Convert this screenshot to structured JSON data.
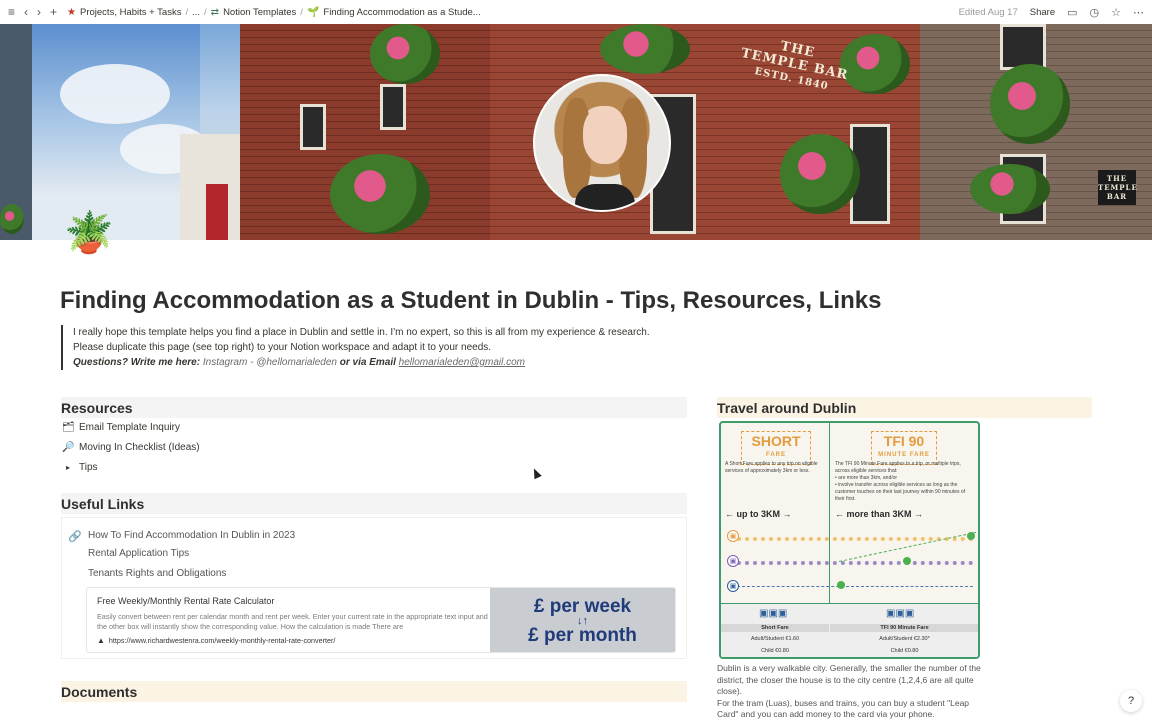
{
  "topbar": {
    "breadcrumbs": [
      {
        "icon": "★",
        "label": "Projects, Habits + Tasks"
      },
      {
        "icon": "",
        "label": "..."
      },
      {
        "icon": "⇄",
        "label": "Notion Templates"
      },
      {
        "icon": "🌱",
        "label": "Finding Accommodation as a Stude..."
      }
    ],
    "edited": "Edited Aug 17",
    "share": "Share"
  },
  "page": {
    "icon": "🪴",
    "title": "Finding Accommodation as a Student in Dublin - Tips, Resources, Links"
  },
  "callout": {
    "line1": "I really hope this template helps you find a place in Dublin and settle in. I'm no expert, so this is all from my experience & research.",
    "line2": "Please duplicate this page (see top right) to your Notion workspace and adapt it to your needs.",
    "q_label": "Questions? Write me here:",
    "instagram": "Instagram - @hellomarialeden",
    "or_email": "or via Email",
    "email": "hellomarialeden@gmail.com"
  },
  "cover": {
    "sign1": "THE",
    "sign2": "TEMPLE BAR",
    "sign3": "ESTD. 1840",
    "sign_right1": "THE",
    "sign_right2": "TEMPLE",
    "sign_right3": "BAR"
  },
  "resources": {
    "heading": "Resources",
    "items": [
      {
        "icon": "🗂",
        "label": "Email Template Inquiry"
      },
      {
        "icon": "🔎",
        "label": "Moving In Checklist (Ideas)"
      },
      {
        "icon": "▸",
        "label": "Tips"
      }
    ]
  },
  "useful_links": {
    "heading": "Useful Links",
    "items": [
      "How To Find Accommodation In Dublin in 2023",
      "Rental Application Tips",
      "Tenants Rights and Obligations"
    ],
    "bookmark": {
      "title": "Free Weekly/Monthly Rental Rate Calculator",
      "description": "Easily convert between rent per calendar month and rent per week. Enter your current rate in the appropriate text input and the other box will instantly show the corresponding value. How the calculation is made There are",
      "url": "https://www.richardwestenra.com/weekly-monthly-rental-rate-converter/",
      "thumb_line1": "£ per week",
      "thumb_line2": "£ per month"
    }
  },
  "documents": {
    "heading": "Documents"
  },
  "travel": {
    "heading": "Travel around Dublin",
    "short_title": "SHORT",
    "short_sub": "FARE",
    "short_desc": "A Short Fare applies to any trip on eligible services of approximately 3km or less.",
    "tfi_title": "TFI 90",
    "tfi_sub": "MINUTE FARE",
    "tfi_desc1": "The TFI 90 Minute Fare applies to a trip, or multiple trips, across eligible services that:",
    "tfi_desc2": "• are more than 3km, and/or",
    "tfi_desc3": "• involve transfer across eligible services as long as the customer touches on their last journey within 90 minutes of their first.",
    "range_short": "up to 3KM",
    "range_long": "more than 3KM",
    "foot_short_label": "Short Fare",
    "foot_tfi_label": "TFI 90 Minute Fare",
    "short_adult": "Adult/Student €1.60",
    "short_child": "Child €0.80",
    "tfi_adult": "Adult/Student €2.30*",
    "tfi_child": "Child €0.80",
    "text1": "Dublin is a very walkable city. Generally, the smaller the number of the district, the closer the house is to the city centre (1,2,4,6 are all quite close).",
    "text2": "For the tram (Luas), buses and trains, you can buy a student \"Leap Card\" and you can add money to the card via your phone."
  },
  "help": "?"
}
